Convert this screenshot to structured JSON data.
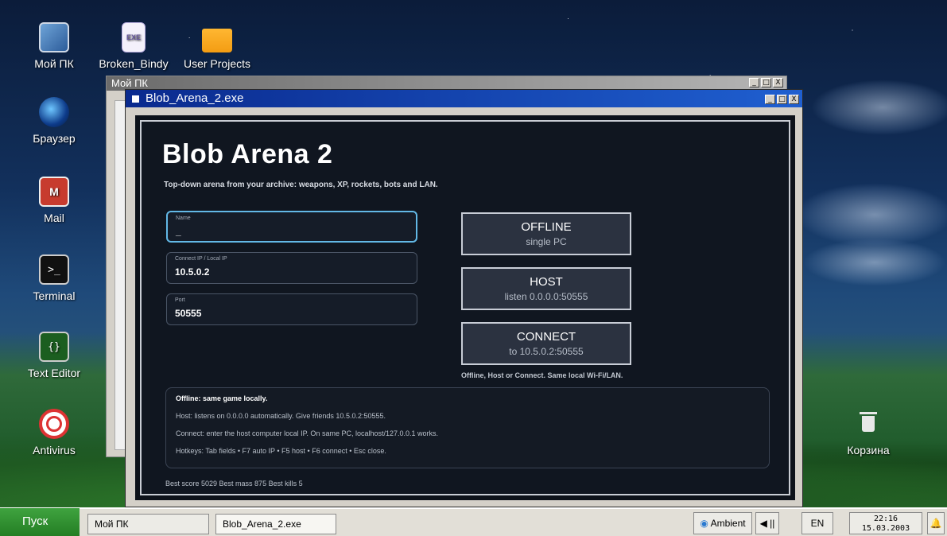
{
  "desktop": {
    "icons": [
      {
        "label": "Мой ПК",
        "icon": "computer-icon"
      },
      {
        "label": "Broken_Bindy",
        "icon": "exe-file-icon",
        "glyph": "EXE"
      },
      {
        "label": "User Projects",
        "icon": "folder-icon"
      },
      {
        "label": "Браузер",
        "icon": "browser-icon"
      },
      {
        "label": "Mail",
        "icon": "mail-icon",
        "glyph": "M"
      },
      {
        "label": "Terminal",
        "icon": "terminal-icon",
        "glyph": ">_"
      },
      {
        "label": "Text Editor",
        "icon": "text-editor-icon",
        "glyph": "{}"
      },
      {
        "label": "Antivirus",
        "icon": "antivirus-icon"
      },
      {
        "label": "Корзина",
        "icon": "trash-icon"
      }
    ]
  },
  "back_window": {
    "title": "Мой ПК"
  },
  "main_window": {
    "title": "Blob_Arena_2.exe"
  },
  "window_buttons": {
    "minimize": "_",
    "maximize": "□",
    "close": "X"
  },
  "game": {
    "title": "Blob Arena 2",
    "subtitle": "Top-down arena from your archive: weapons, XP, rockets, bots and LAN.",
    "fields": {
      "name": {
        "label": "Name",
        "value": "_"
      },
      "ip": {
        "label": "Connect IP / Local IP",
        "value": "10.5.0.2"
      },
      "port": {
        "label": "Port",
        "value": "50555"
      }
    },
    "buttons": {
      "offline": {
        "title": "OFFLINE",
        "sub": "single PC"
      },
      "host": {
        "title": "HOST",
        "sub": "listen 0.0.0.0:50555"
      },
      "connect": {
        "title": "CONNECT",
        "sub": "to 10.5.0.2:50555"
      }
    },
    "hint": "Offline, Host or Connect. Same local Wi-Fi/LAN.",
    "info": [
      "Offline: same game locally.",
      "Host: listens on 0.0.0.0 automatically. Give friends 10.5.0.2:50555.",
      "Connect: enter the host computer local IP. On same PC, localhost/127.0.0.1 works.",
      "Hotkeys: Tab fields • F7 auto IP • F5 host • F6 connect • Esc close."
    ],
    "stats": "Best score 5029   Best mass 875   Best kills 5"
  },
  "taskbar": {
    "start": "Пуск",
    "tasks": [
      "Мой ПК",
      "Blob_Arena_2.exe"
    ],
    "ambient": "Ambient",
    "volume": "◀ ||",
    "lang": "EN",
    "time": "22:16",
    "date": "15.03.2003"
  }
}
